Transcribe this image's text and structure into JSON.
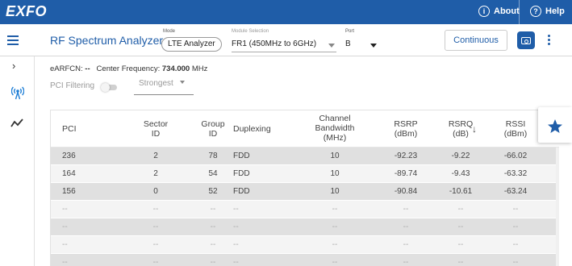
{
  "topbar": {
    "logo": "EXFO",
    "about_label": "About",
    "help_label": "Help",
    "color": "#1f5da8"
  },
  "toolbar": {
    "title": "RF Spectrum Analyzer",
    "mode_label": "Mode",
    "mode_value": "LTE Analyzer",
    "module_label": "Module Selection",
    "module_value": "FR1 (450MHz to 6GHz)",
    "port_label": "Port",
    "port_value": "B",
    "continuous_label": "Continuous"
  },
  "rail": {
    "items": [
      "chevron-right-icon",
      "antenna-icon",
      "trend-icon"
    ]
  },
  "info": {
    "earfcn_label": "eARFCN:",
    "earfcn_value": "--",
    "center_freq_label": "Center Frequency:",
    "center_freq_value": "734.000",
    "center_freq_unit": "MHz"
  },
  "filter": {
    "pci_filtering_label": "PCI Filtering",
    "pci_filtering_on": false,
    "sort_value": "Strongest"
  },
  "table": {
    "headers": [
      {
        "l1": "PCI",
        "l2": "",
        "l3": ""
      },
      {
        "l1": "Sector",
        "l2": "ID",
        "l3": ""
      },
      {
        "l1": "Group",
        "l2": "ID",
        "l3": ""
      },
      {
        "l1": "Duplexing",
        "l2": "",
        "l3": ""
      },
      {
        "l1": "Channel",
        "l2": "Bandwidth",
        "l3": "(MHz)"
      },
      {
        "l1": "RSRP",
        "l2": "(dBm)",
        "l3": ""
      },
      {
        "l1": "RSRQ",
        "l2": "(dB)",
        "l3": ""
      },
      {
        "l1": "RSSI",
        "l2": "(dBm)",
        "l3": ""
      }
    ],
    "sort_indicator": "↓",
    "rows": [
      [
        "236",
        "2",
        "78",
        "FDD",
        "10",
        "-92.23",
        "-9.22",
        "-66.02"
      ],
      [
        "164",
        "2",
        "54",
        "FDD",
        "10",
        "-89.74",
        "-9.43",
        "-63.32"
      ],
      [
        "156",
        "0",
        "52",
        "FDD",
        "10",
        "-90.84",
        "-10.61",
        "-63.24"
      ],
      [
        "--",
        "--",
        "--",
        "--",
        "--",
        "--",
        "--",
        "--"
      ],
      [
        "--",
        "--",
        "--",
        "--",
        "--",
        "--",
        "--",
        "--"
      ],
      [
        "--",
        "--",
        "--",
        "--",
        "--",
        "--",
        "--",
        "--"
      ],
      [
        "--",
        "--",
        "--",
        "--",
        "--",
        "--",
        "--",
        "--"
      ]
    ]
  },
  "favorite": {
    "icon": "star-icon"
  }
}
